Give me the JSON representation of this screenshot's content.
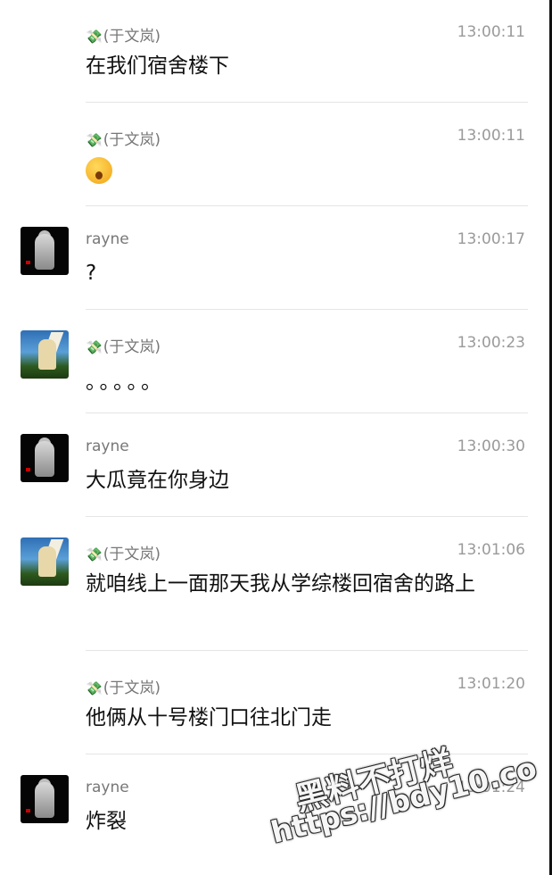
{
  "name_prefix": "💸",
  "messages": [
    {
      "sender": "(于文岚)",
      "time": "13:00:11",
      "text": "在我们宿舍楼下",
      "avatar": "none"
    },
    {
      "sender": "(于文岚)",
      "time": "13:00:11",
      "text": "",
      "emoji": "hushed-face-emoji",
      "avatar": "none"
    },
    {
      "sender": "rayne",
      "time": "13:00:17",
      "text": "?",
      "avatar": "dark-portrait"
    },
    {
      "sender": "(于文岚)",
      "time": "13:00:23",
      "text": "。。。。。",
      "avatar": "sky-portrait"
    },
    {
      "sender": "rayne",
      "time": "13:00:30",
      "text": "大瓜竟在你身边",
      "avatar": "dark-portrait"
    },
    {
      "sender": "(于文岚)",
      "time": "13:01:06",
      "text": "就咱线上一面那天我从学综楼回宿舍的路上",
      "avatar": "sky-portrait"
    },
    {
      "sender": "(于文岚)",
      "time": "13:01:20",
      "text": "他俩从十号楼门口往北门走",
      "avatar": "none"
    },
    {
      "sender": "rayne",
      "time": "13:01:24",
      "text": "炸裂",
      "avatar": "dark-portrait"
    }
  ],
  "watermark": {
    "line1": "黑料不打烊",
    "line2": "https://bdy10.co"
  }
}
